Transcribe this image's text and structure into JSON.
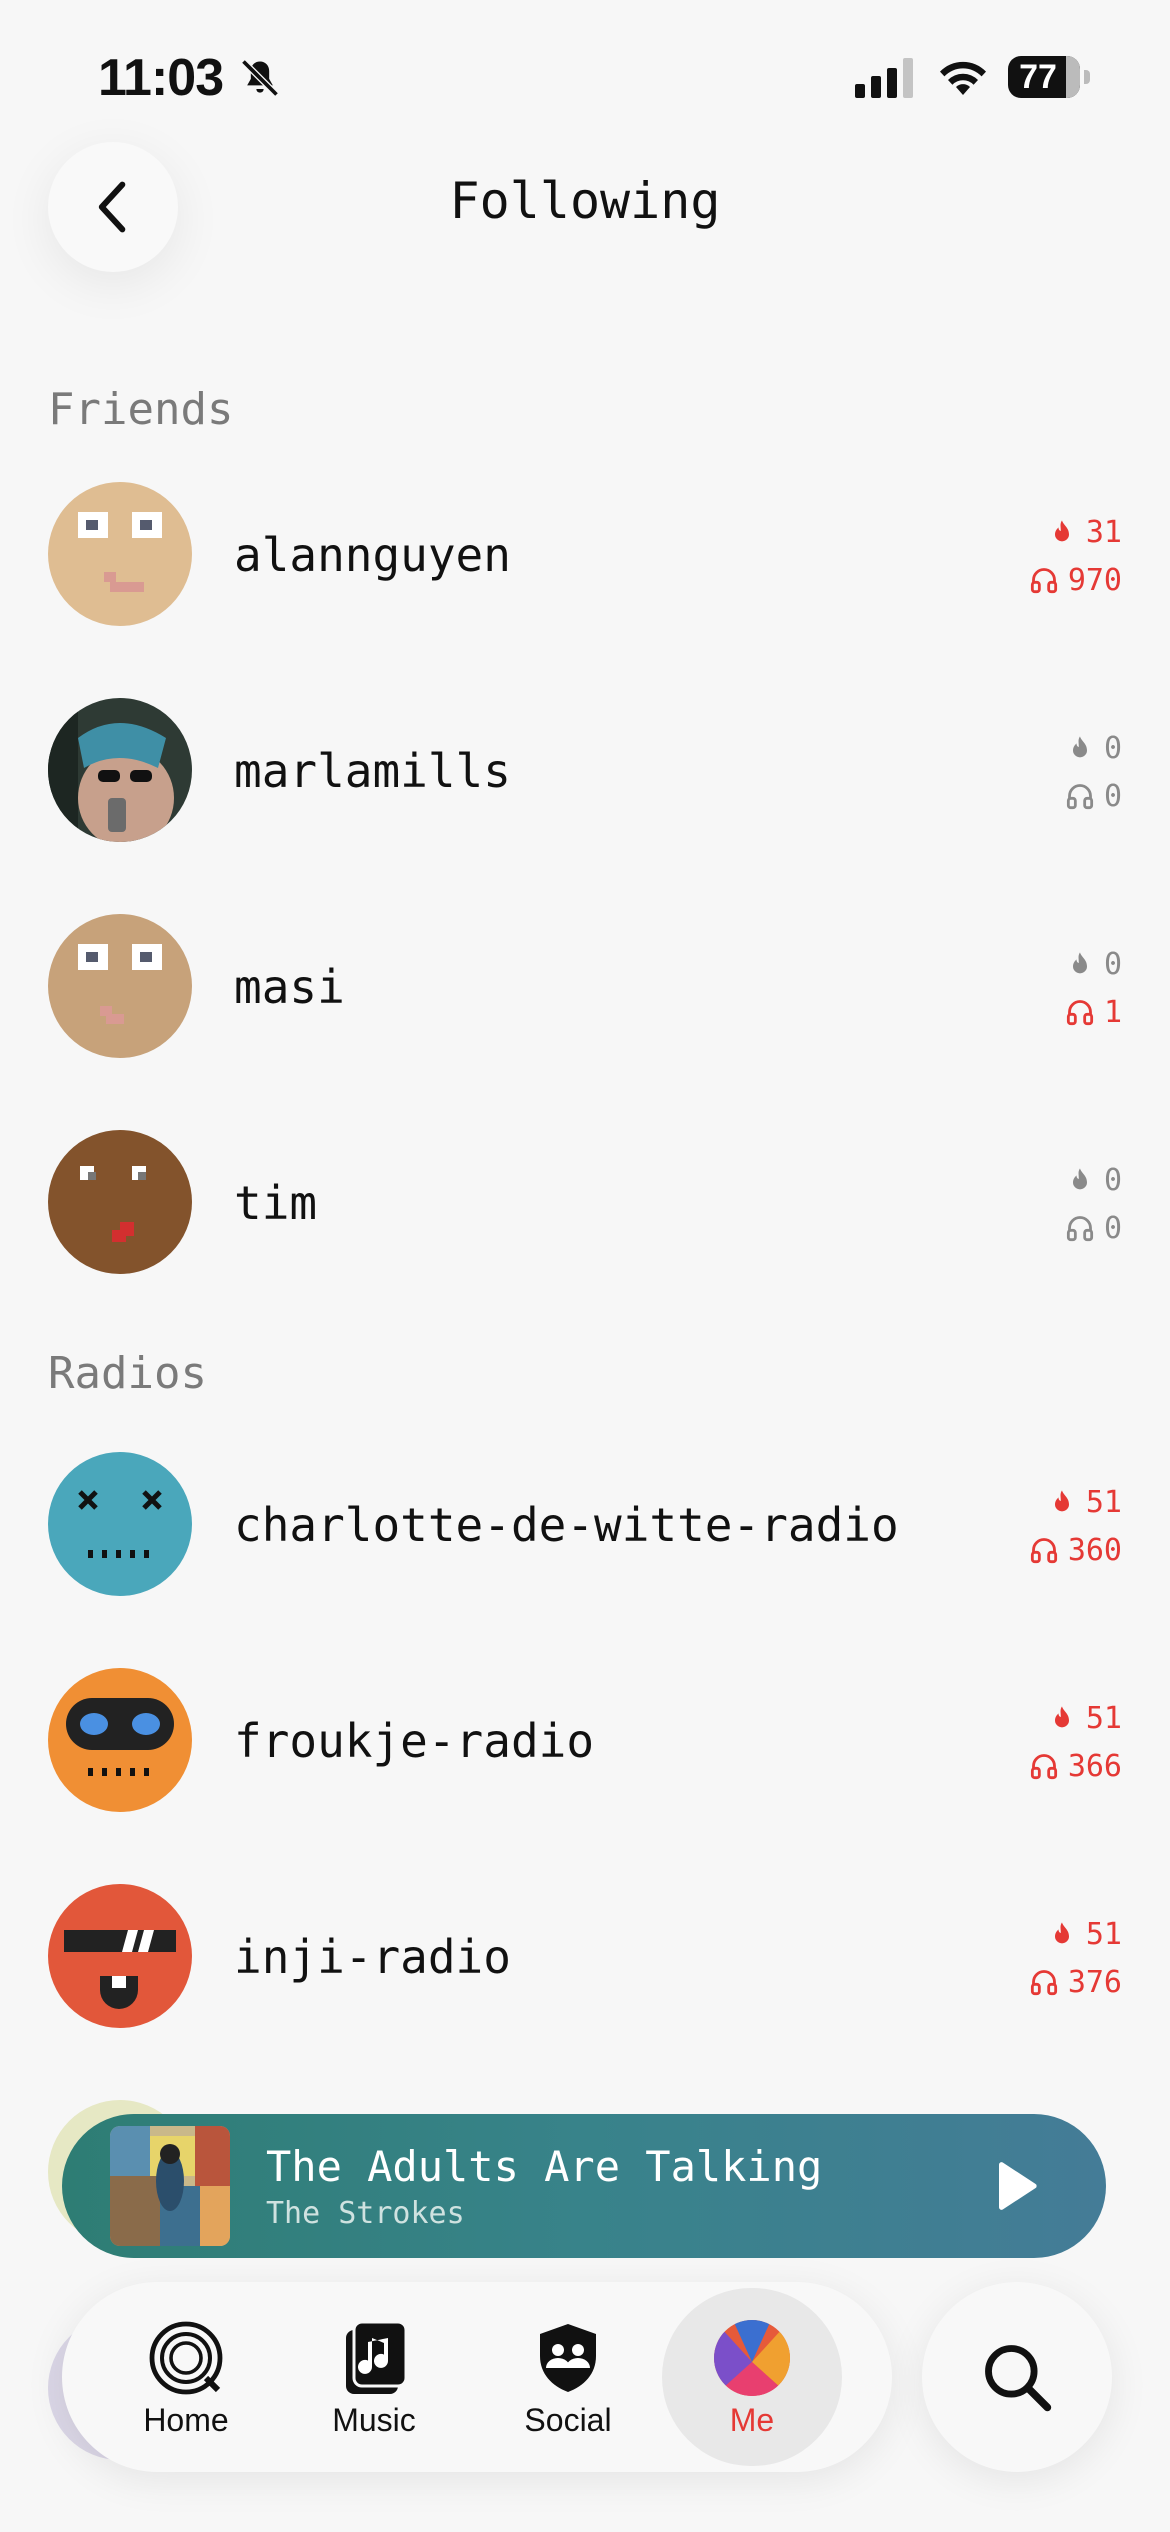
{
  "status_bar": {
    "time": "11:03",
    "battery": "77"
  },
  "header": {
    "title": "Following"
  },
  "sections": {
    "friends_label": "Friends",
    "radios_label": "Radios"
  },
  "friends": [
    {
      "name": "alannguyen",
      "streak": "31",
      "listens": "970",
      "streak_color": "red",
      "listens_color": "red"
    },
    {
      "name": "marlamills",
      "streak": "0",
      "listens": "0",
      "streak_color": "gray",
      "listens_color": "gray"
    },
    {
      "name": "masi",
      "streak": "0",
      "listens": "1",
      "streak_color": "gray",
      "listens_color": "red"
    },
    {
      "name": "tim",
      "streak": "0",
      "listens": "0",
      "streak_color": "gray",
      "listens_color": "gray"
    }
  ],
  "radios": [
    {
      "name": "charlotte-de-witte-radio",
      "streak": "51",
      "listens": "360"
    },
    {
      "name": "froukje-radio",
      "streak": "51",
      "listens": "366"
    },
    {
      "name": "inji-radio",
      "streak": "51",
      "listens": "376"
    }
  ],
  "now_playing": {
    "title": "The Adults Are Talking",
    "artist": "The Strokes"
  },
  "tabs": [
    {
      "label": "Home",
      "icon": "home-rings-icon"
    },
    {
      "label": "Music",
      "icon": "music-note-icon"
    },
    {
      "label": "Social",
      "icon": "social-shield-icon"
    },
    {
      "label": "Me",
      "icon": "me-avatar-icon",
      "active": true
    }
  ],
  "colors": {
    "accent": "#e53935",
    "player": "#3a8288",
    "muted": "#8a8a8a"
  }
}
